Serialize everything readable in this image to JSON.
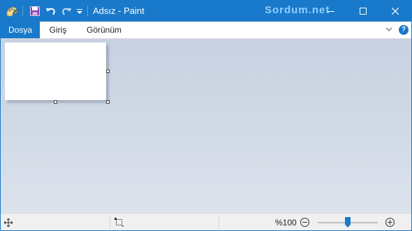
{
  "window": {
    "title": "Adsız - Paint",
    "watermark": "Sordum.net"
  },
  "quick_access": {
    "icons": [
      "paint-app-icon",
      "save-icon",
      "undo-icon",
      "redo-icon",
      "customize-dropdown-icon"
    ]
  },
  "window_controls": [
    "minimize-icon",
    "maximize-icon",
    "close-icon"
  ],
  "ribbon": {
    "tabs": [
      {
        "label": "Dosya",
        "active": true
      },
      {
        "label": "Giriş",
        "active": false
      },
      {
        "label": "Görünüm",
        "active": false
      }
    ],
    "collapse_icon": "chevron-down-icon",
    "help_label": "?"
  },
  "status": {
    "cursor_icon": "cursor-position-icon",
    "selection_icon": "selection-size-icon",
    "zoom_label": "%100",
    "zoom_level_fraction": 0.5
  },
  "colors": {
    "accent": "#1979ca",
    "workspace_top": "#c7d1e0",
    "workspace_bottom": "#dbe2ec",
    "canvas": "#ffffff"
  }
}
